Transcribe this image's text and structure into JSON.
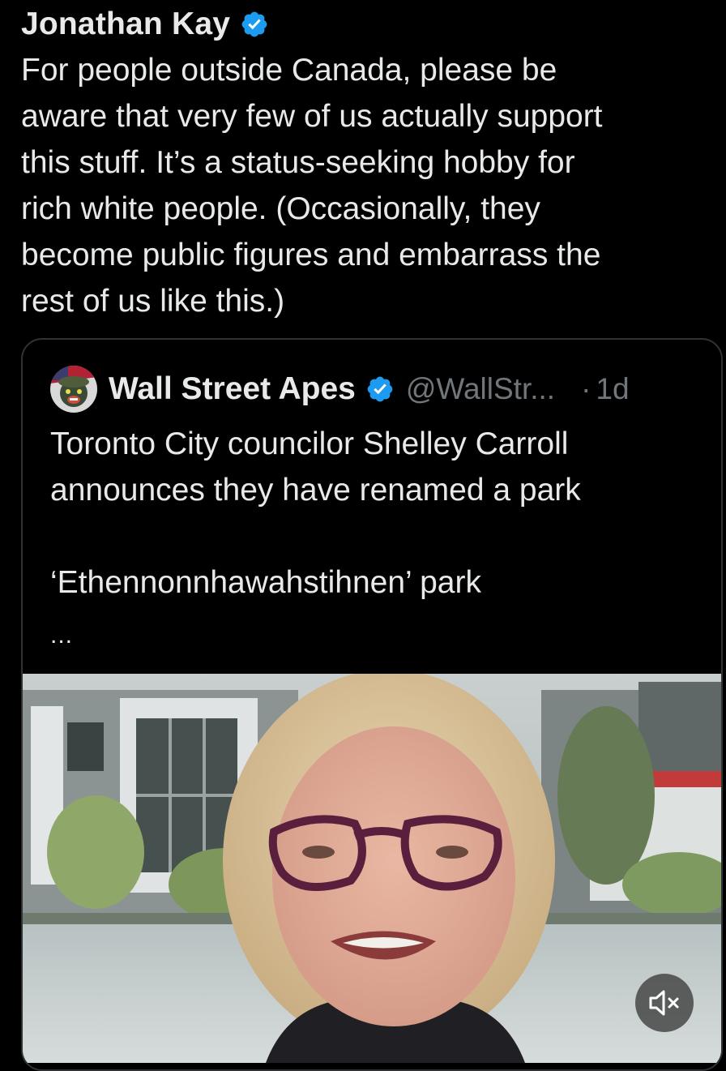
{
  "tweet": {
    "author_name": "Jonathan Kay",
    "verified_icon": "verified-badge-icon",
    "text": "For people outside Canada, please be\naware that very few of us actually support\nthis stuff. It’s a status-seeking hobby for\nrich white people. (Occasionally, they\nbecome public figures and embarrass the\nrest of us like this.)"
  },
  "quote": {
    "author_name": "Wall Street Apes",
    "handle": "@WallStr...",
    "separator": "·",
    "time": "1d",
    "text": "Toronto City councilor Shelley Carroll\nannounces they have renamed a park\n\n‘Ethennonnhawahstihnen’ park",
    "more": "...",
    "media": {
      "type": "video",
      "mute_icon": "speaker-muted-icon"
    }
  },
  "colors": {
    "background": "#000000",
    "text": "#e7e9ea",
    "secondary": "#71767b",
    "verified_blue": "#1d9bf0",
    "border": "#2f3336"
  }
}
